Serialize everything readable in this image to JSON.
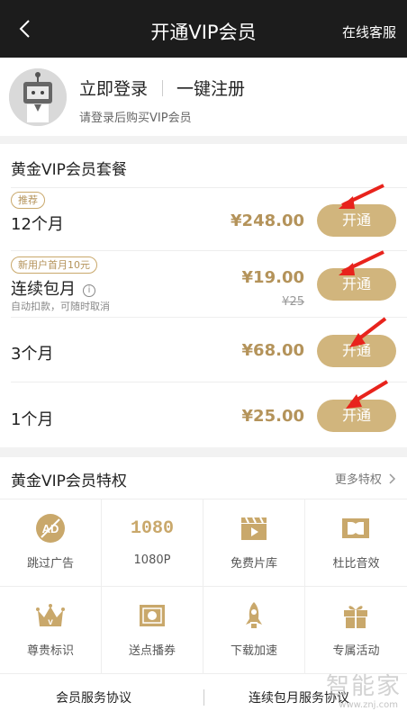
{
  "nav": {
    "back_icon": "chevron-left-icon",
    "title": "开通VIP会员",
    "right_label": "在线客服"
  },
  "login": {
    "login_label": "立即登录",
    "register_label": "一键注册",
    "hint": "请登录后购买VIP会员"
  },
  "plans": {
    "title": "黄金VIP会员套餐",
    "open_label": "开通",
    "items": [
      {
        "badge": "推荐",
        "name": "12个月",
        "price": "¥248.00"
      },
      {
        "badge": "新用户首月10元",
        "name": "连续包月",
        "note": "自动扣款，可随时取消",
        "info": "i",
        "price": "¥19.00",
        "old_price": "¥25"
      },
      {
        "name": "3个月",
        "price": "¥68.00"
      },
      {
        "name": "1个月",
        "price": "¥25.00"
      }
    ]
  },
  "privileges": {
    "title": "黄金VIP会员特权",
    "more": "更多特权",
    "items": [
      {
        "label": "跳过广告",
        "icon": "no-ad-icon"
      },
      {
        "label": "1080P",
        "icon": "1080-icon",
        "icon_text": "1080"
      },
      {
        "label": "免费片库",
        "icon": "clapperboard-icon"
      },
      {
        "label": "杜比音效",
        "icon": "dolby-icon"
      },
      {
        "label": "尊贵标识",
        "icon": "crown-icon"
      },
      {
        "label": "送点播券",
        "icon": "ticket-icon"
      },
      {
        "label": "下载加速",
        "icon": "rocket-icon"
      },
      {
        "label": "专属活动",
        "icon": "gift-icon"
      }
    ]
  },
  "footer": {
    "left": "会员服务协议",
    "right": "连续包月服务协议"
  },
  "watermark": {
    "main": "智能家",
    "sub": "www.znj.com"
  },
  "colors": {
    "gold": "#d1b57d",
    "gold_text": "#b4935a",
    "arrow": "#e8231c",
    "navbar": "#1c1c1c"
  }
}
